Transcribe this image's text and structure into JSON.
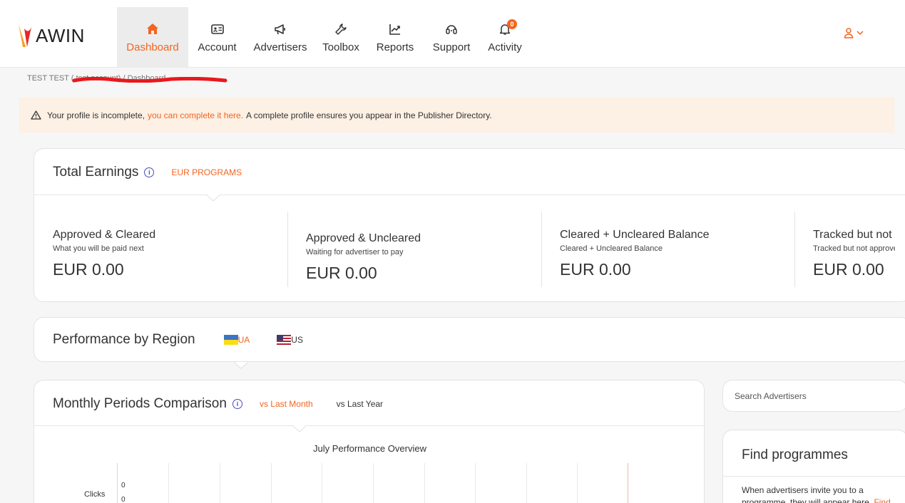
{
  "brand": {
    "logo_text": "AWIN",
    "accent": "#f26522"
  },
  "nav": {
    "items": [
      {
        "label": "Dashboard",
        "icon": "home-icon",
        "active": true
      },
      {
        "label": "Account",
        "icon": "id-card-icon"
      },
      {
        "label": "Advertisers",
        "icon": "megaphone-icon"
      },
      {
        "label": "Toolbox",
        "icon": "wrench-icon"
      },
      {
        "label": "Reports",
        "icon": "chart-line-icon"
      },
      {
        "label": "Support",
        "icon": "headset-icon"
      },
      {
        "label": "Activity",
        "icon": "bell-icon",
        "badge": "0"
      }
    ]
  },
  "breadcrumb": "TEST TEST (                        test account) / Dashboard",
  "alert": {
    "prefix": "Your profile is incomplete,",
    "link": "you can complete it here.",
    "suffix": "A complete profile ensures you appear in the Publisher Directory."
  },
  "earnings": {
    "title": "Total Earnings",
    "tab": "EUR PROGRAMS",
    "columns": [
      {
        "title": "Approved & Cleared",
        "sub": "What you will be paid next",
        "value": "EUR 0.00"
      },
      {
        "title": "Approved & Uncleared",
        "sub": "Waiting for advertiser to pay",
        "value": "EUR 0.00"
      },
      {
        "title": "Cleared + Uncleared Balance",
        "sub": "Cleared + Uncleared Balance",
        "value": "EUR 0.00"
      },
      {
        "title": "Tracked but not approved",
        "sub": "Tracked but not approved",
        "value": "EUR 0.00"
      }
    ]
  },
  "region": {
    "title": "Performance by Region",
    "flags": [
      {
        "code": "UA",
        "active": true
      },
      {
        "code": "US",
        "active": false
      }
    ]
  },
  "monthly": {
    "title": "Monthly Periods Comparison",
    "tabs": [
      {
        "label": "vs Last Month",
        "active": true
      },
      {
        "label": "vs Last Year",
        "active": false
      }
    ],
    "chart_title": "July Performance Overview",
    "row_label": "Clicks",
    "axis_value": "0",
    "axis_value_2": "0"
  },
  "search": {
    "placeholder": "Search Advertisers"
  },
  "find": {
    "title": "Find programmes",
    "text": "When advertisers invite you to a programme, they will appear here.",
    "link": "Find programmes"
  }
}
